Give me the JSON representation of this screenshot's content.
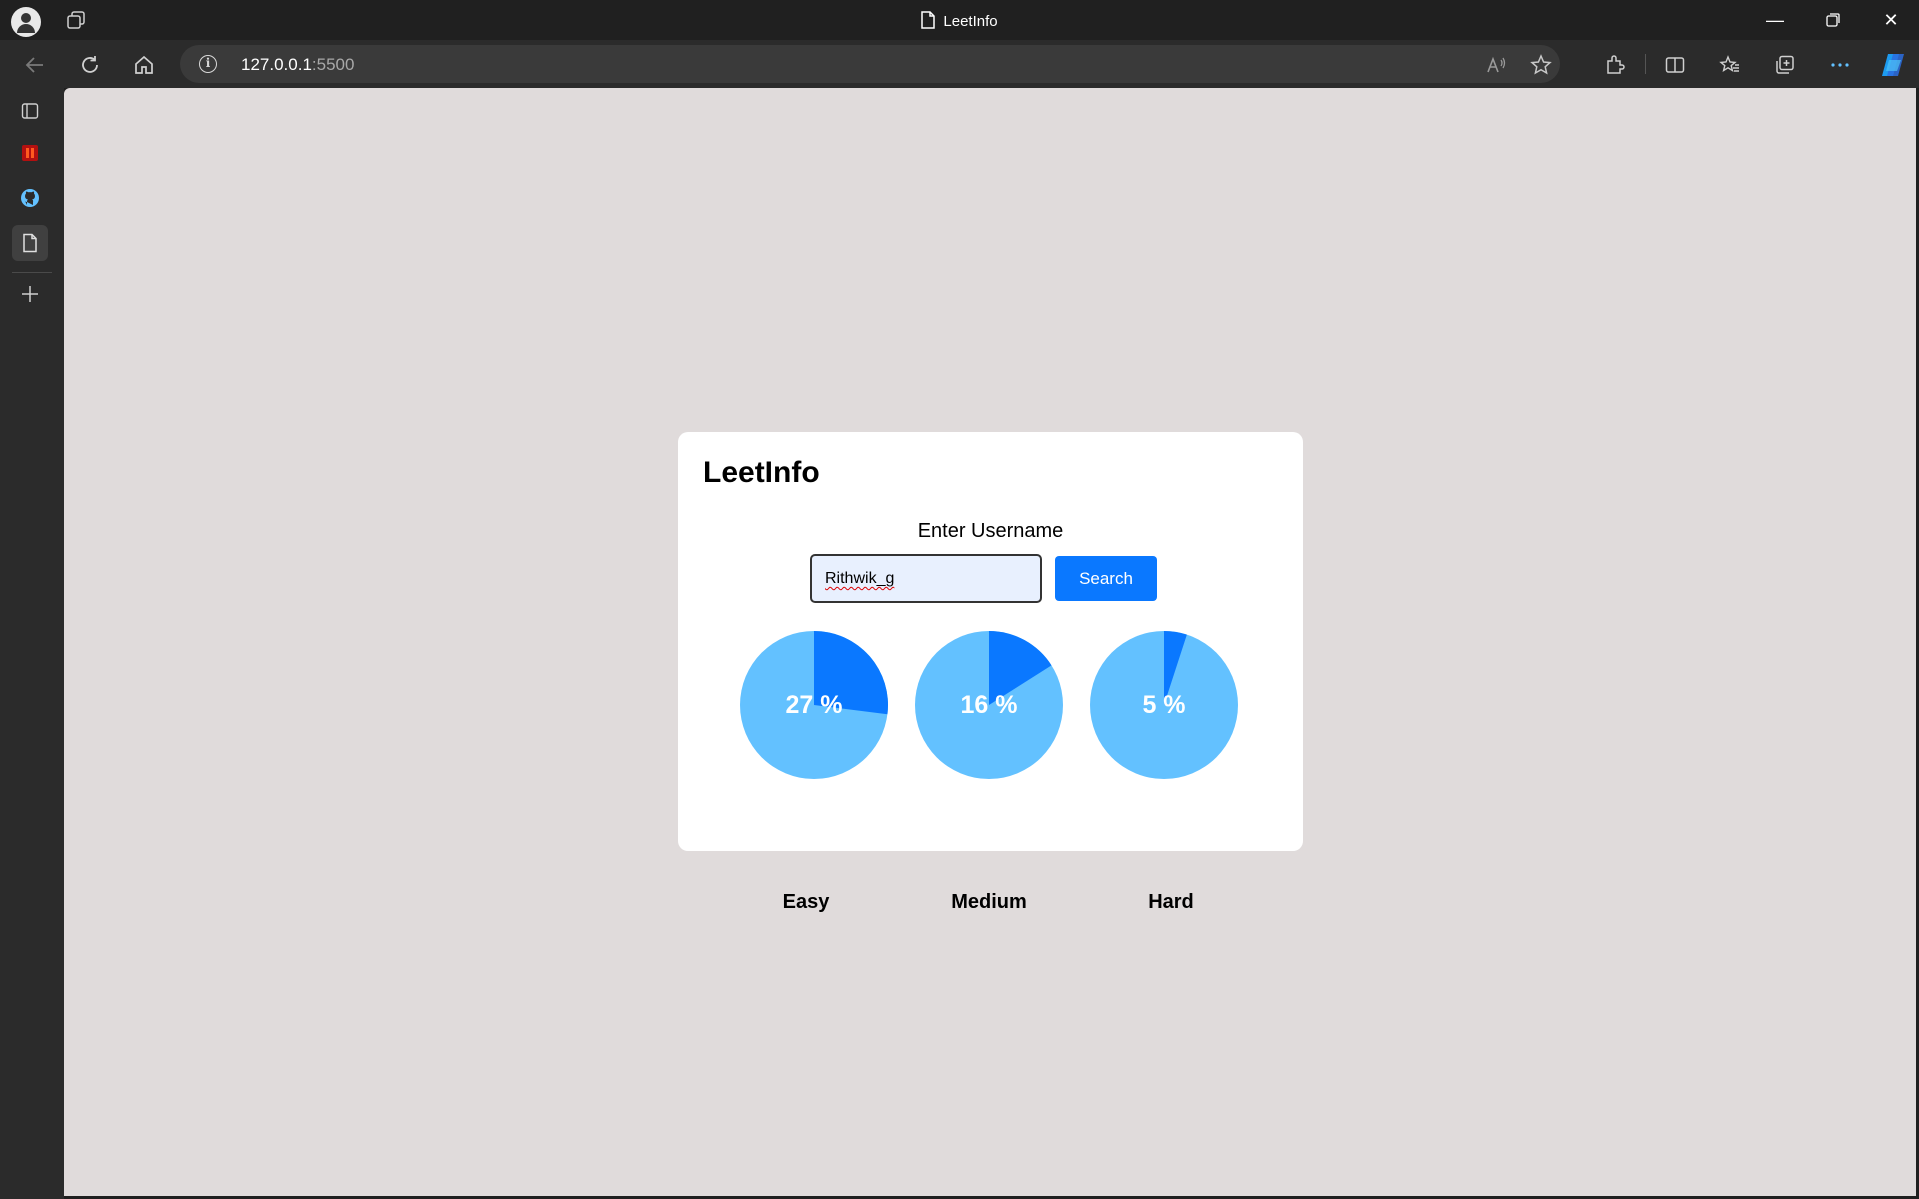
{
  "browser": {
    "tab_title": "LeetInfo",
    "url_host": "127.0.0.1",
    "url_port": ":5500"
  },
  "page": {
    "title": "LeetInfo",
    "username_label": "Enter Username",
    "username_value": "Rithwik_g",
    "search_label": "Search"
  },
  "stats": [
    {
      "name": "Easy",
      "percent": 27,
      "percent_label": "27 %"
    },
    {
      "name": "Medium",
      "percent": 16,
      "percent_label": "16 %"
    },
    {
      "name": "Hard",
      "percent": 5,
      "percent_label": "5 %"
    }
  ],
  "colors": {
    "pie_base": "#63c1ff",
    "pie_fill": "#0a78ff",
    "button": "#0a78ff",
    "page_bg": "#e0dbdb"
  }
}
